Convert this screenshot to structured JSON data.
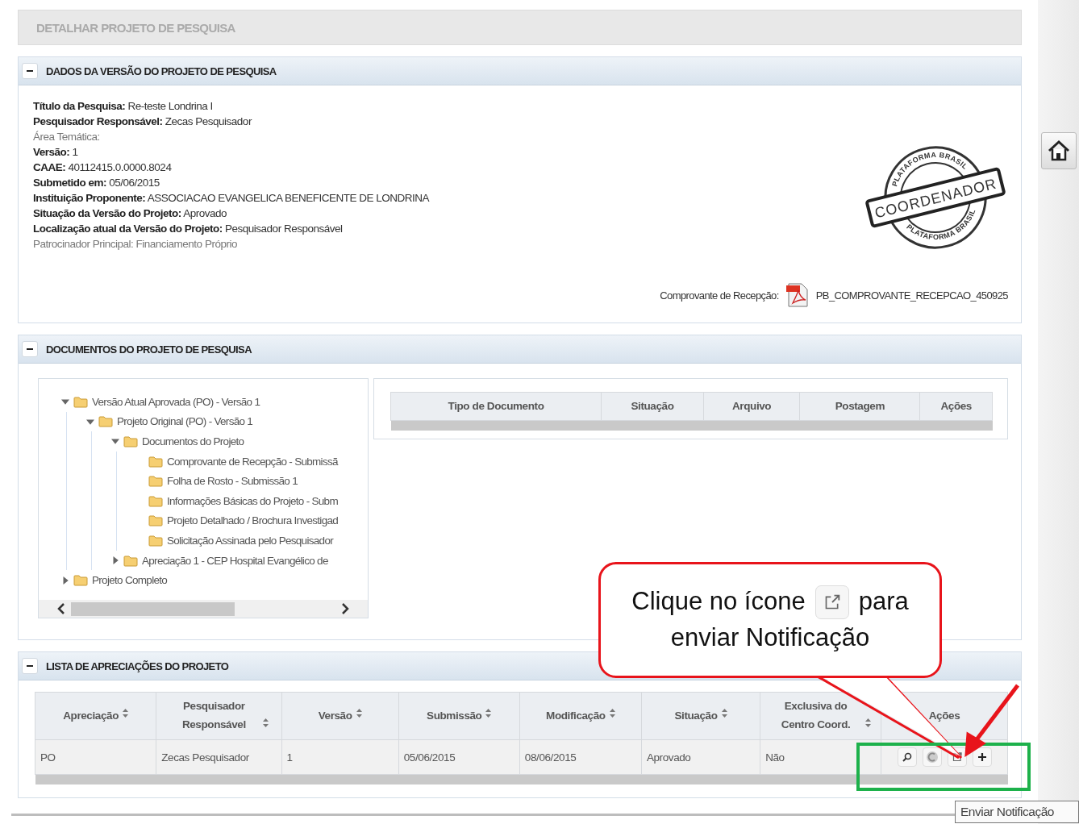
{
  "page_title": "DETALHAR PROJETO DE PESQUISA",
  "project_section": {
    "title": "DADOS DA VERSÃO DO PROJETO DE PESQUISA",
    "expanded": true,
    "fields": [
      {
        "label": "Título da Pesquisa:",
        "value": "Re-teste Londrina I",
        "kind": "bold"
      },
      {
        "label": "Pesquisador Responsável:",
        "value": "Zecas Pesquisador",
        "kind": "bold"
      },
      {
        "label": "Área Temática:",
        "kind": "muted"
      },
      {
        "label": "Versão:",
        "value": "1",
        "kind": "bold"
      },
      {
        "label": "CAAE:",
        "value": "40112415.0.0000.8024",
        "kind": "bold"
      },
      {
        "label": "Submetido em:",
        "value": "05/06/2015",
        "kind": "bold"
      },
      {
        "label": "Instituição Proponente:",
        "value": "ASSOCIACAO EVANGELICA BENEFICENTE DE LONDRINA",
        "kind": "bold"
      },
      {
        "label": "Situação da Versão do Projeto:",
        "value": "Aprovado",
        "kind": "bold"
      },
      {
        "label": "Localização atual da Versão do Projeto:",
        "value": "Pesquisador Responsável",
        "kind": "bold"
      },
      {
        "label": "Patrocinador Principal:",
        "value": "Financiamento Próprio",
        "kind": "muted"
      }
    ],
    "stamp": {
      "text": "COORDENADOR",
      "ring_top": "PLATAFORMA BRASIL",
      "ring_bottom": "PLATAFORMA BRASIL"
    },
    "receipt": {
      "label": "Comprovante de Recepção:",
      "file": "PB_COMPROVANTE_RECEPCAO_450925"
    }
  },
  "documents_section": {
    "title": "DOCUMENTOS DO PROJETO DE PESQUISA",
    "expanded": true,
    "tree": [
      {
        "label": "Versão Atual Aprovada (PO) - Versão 1",
        "expanded": true,
        "children": [
          {
            "label": "Projeto Original (PO) - Versão 1",
            "expanded": true,
            "children": [
              {
                "label": "Documentos do Projeto",
                "expanded": true,
                "children": [
                  {
                    "label": "Comprovante de Recepção - Submissã"
                  },
                  {
                    "label": "Folha de Rosto - Submissão 1"
                  },
                  {
                    "label": "Informações Básicas do Projeto - Subm"
                  },
                  {
                    "label": "Projeto Detalhado / Brochura Investigad"
                  },
                  {
                    "label": "Solicitação Assinada pelo Pesquisador"
                  }
                ]
              },
              {
                "label": "Apreciação 1 - CEP Hospital Evangélico de",
                "expanded": false
              }
            ]
          }
        ]
      },
      {
        "label": "Projeto Completo",
        "expanded": false
      }
    ],
    "table": {
      "columns": [
        "Tipo de Documento",
        "Situação",
        "Arquivo",
        "Postagem",
        "Ações"
      ]
    }
  },
  "appraisals_section": {
    "title": "LISTA DE APRECIAÇÕES DO PROJETO",
    "expanded": true,
    "columns": [
      {
        "label": "Apreciação",
        "sortable": true
      },
      {
        "label": "Pesquisador Responsável",
        "sortable": true
      },
      {
        "label": "Versão",
        "sortable": true
      },
      {
        "label": "Submissão",
        "sortable": true
      },
      {
        "label": "Modificação",
        "sortable": true
      },
      {
        "label": "Situação",
        "sortable": true
      },
      {
        "label": "Exclusiva do Centro Coord.",
        "sortable": true
      },
      {
        "label": "Ações",
        "sortable": false
      }
    ],
    "rows": [
      {
        "cells": [
          "PO",
          "Zecas Pesquisador",
          "1",
          "05/06/2015",
          "08/06/2015",
          "Aprovado",
          "Não"
        ],
        "actions": [
          {
            "kind": "view"
          },
          {
            "kind": "history"
          },
          {
            "kind": "notify"
          },
          {
            "kind": "add"
          }
        ]
      }
    ]
  },
  "callout": {
    "text_before": "Clique no ícone",
    "text_after": "para enviar Notificação"
  },
  "tooltip": "Enviar Notificação"
}
